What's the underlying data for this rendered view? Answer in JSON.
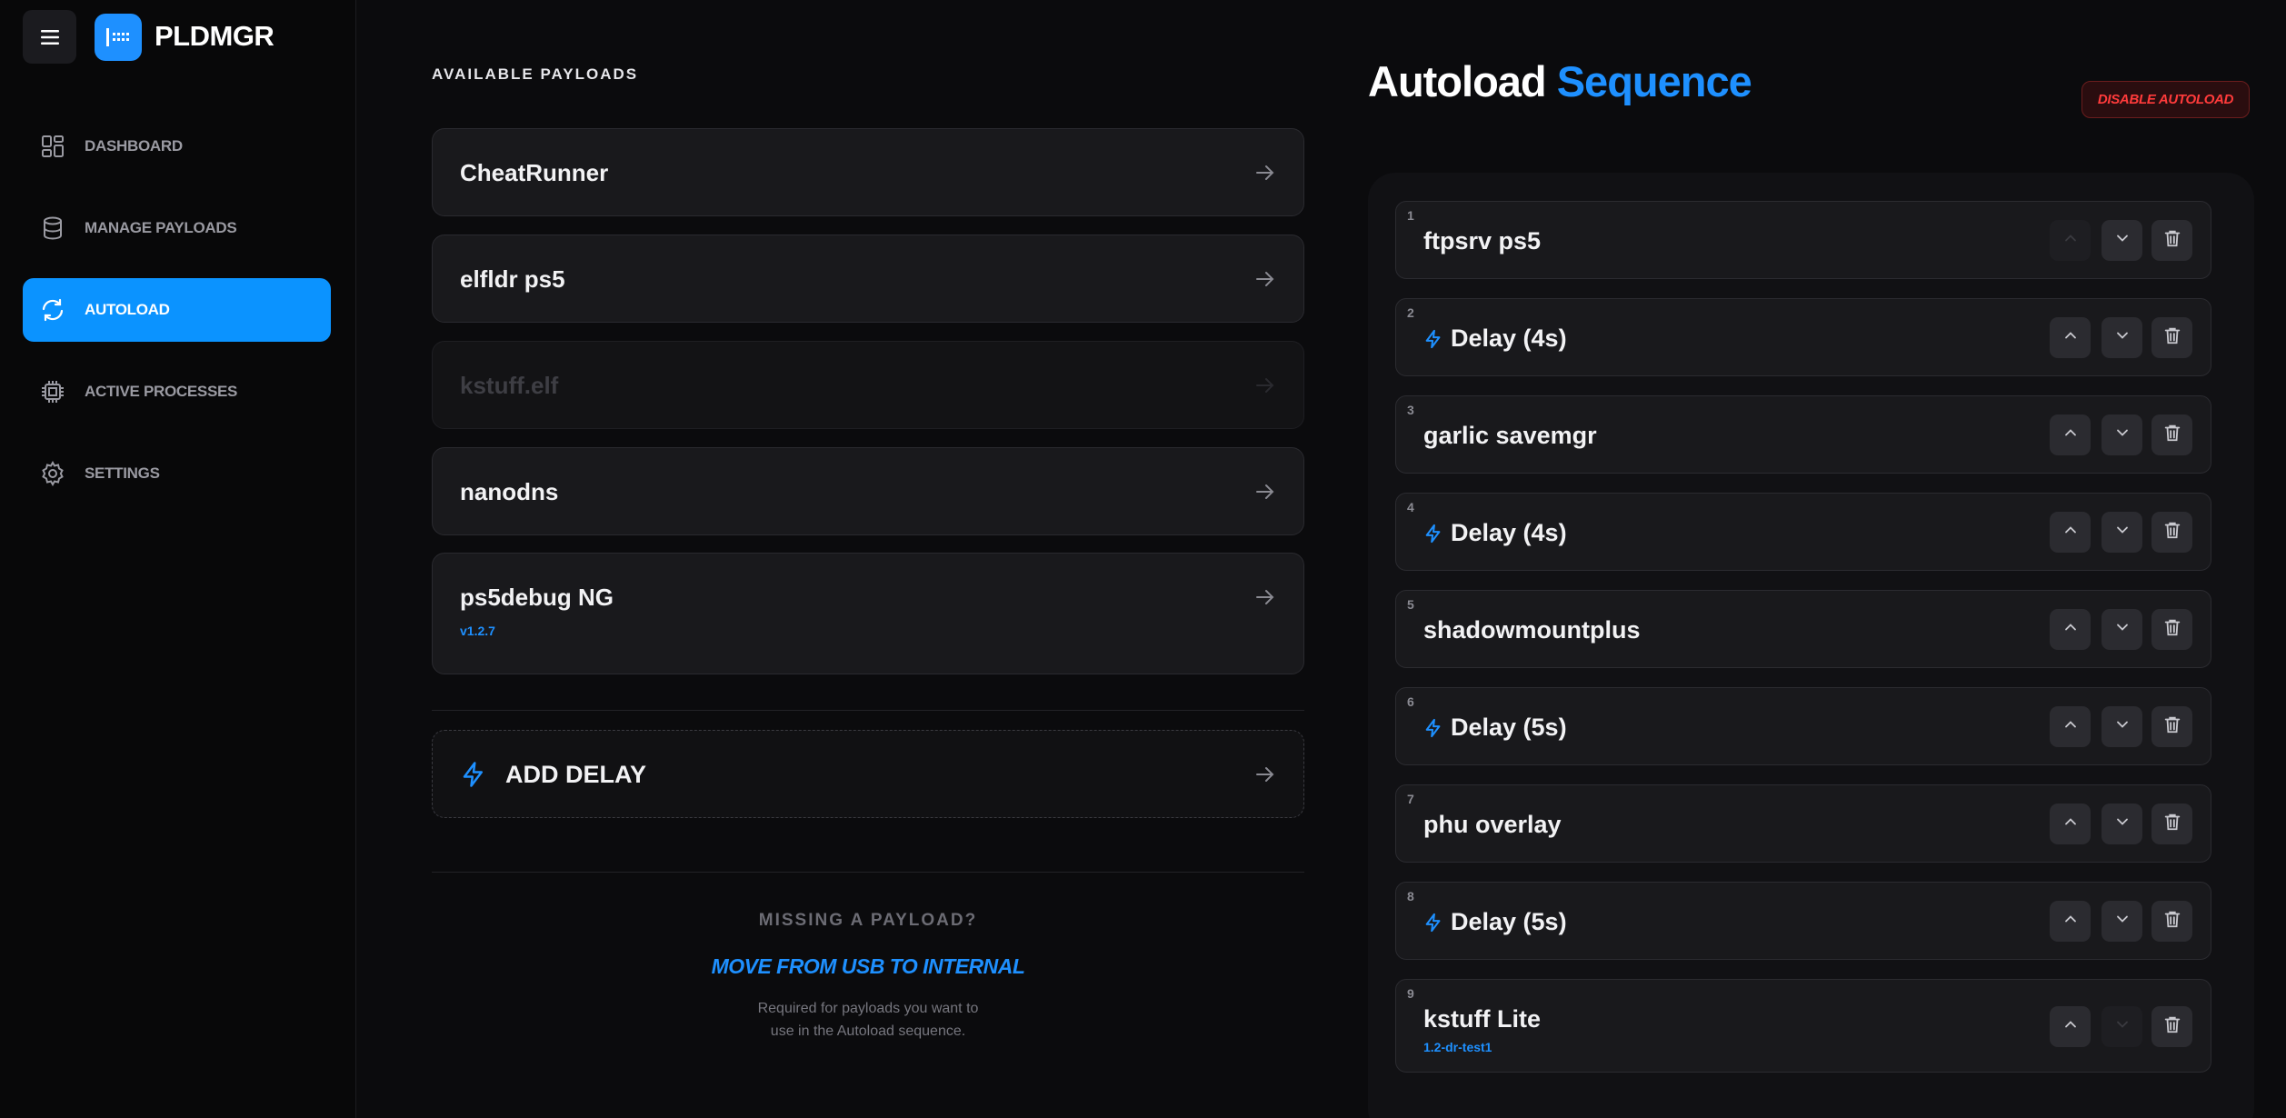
{
  "app": {
    "title": "PLDMGR",
    "icons": {
      "menu": "hamburger-icon",
      "logo": "grid-logo-icon"
    }
  },
  "sidebar": {
    "items": [
      {
        "label": "DASHBOARD",
        "icon": "dashboard-icon",
        "active": false
      },
      {
        "label": "MANAGE PAYLOADS",
        "icon": "database-icon",
        "active": false
      },
      {
        "label": "AUTOLOAD",
        "icon": "refresh-icon",
        "active": true
      },
      {
        "label": "ACTIVE PROCESSES",
        "icon": "cpu-icon",
        "active": false
      },
      {
        "label": "SETTINGS",
        "icon": "gear-icon",
        "active": false
      }
    ]
  },
  "available": {
    "heading": "AVAILABLE PAYLOADS",
    "payloads": [
      {
        "name": "CheatRunner",
        "version": "",
        "enabled": true
      },
      {
        "name": "elfldr ps5",
        "version": "",
        "enabled": true
      },
      {
        "name": "kstuff.elf",
        "version": "",
        "enabled": false
      },
      {
        "name": "nanodns",
        "version": "",
        "enabled": true
      },
      {
        "name": "ps5debug NG",
        "version": "v1.2.7",
        "enabled": true
      }
    ],
    "add_delay_label": "ADD DELAY",
    "missing_label": "MISSING A PAYLOAD?",
    "move_link": "MOVE FROM USB TO INTERNAL",
    "note_line1": "Required for payloads you want to",
    "note_line2": "use in the Autoload sequence."
  },
  "sequence": {
    "title_main": "Autoload",
    "title_accent": "Sequence",
    "disable_button": "DISABLE AUTOLOAD",
    "items": [
      {
        "index": "1",
        "label": "ftpsrv ps5",
        "is_delay": false,
        "sub": ""
      },
      {
        "index": "2",
        "label": "Delay (4s)",
        "is_delay": true,
        "sub": ""
      },
      {
        "index": "3",
        "label": "garlic savemgr",
        "is_delay": false,
        "sub": ""
      },
      {
        "index": "4",
        "label": "Delay (4s)",
        "is_delay": true,
        "sub": ""
      },
      {
        "index": "5",
        "label": "shadowmountplus",
        "is_delay": false,
        "sub": ""
      },
      {
        "index": "6",
        "label": "Delay (5s)",
        "is_delay": true,
        "sub": ""
      },
      {
        "index": "7",
        "label": "phu overlay",
        "is_delay": false,
        "sub": ""
      },
      {
        "index": "8",
        "label": "Delay (5s)",
        "is_delay": true,
        "sub": ""
      },
      {
        "index": "9",
        "label": "kstuff Lite",
        "is_delay": false,
        "sub": "1.2-dr-test1"
      }
    ]
  },
  "colors": {
    "accent": "#1e90ff",
    "active_nav": "#0b93ff",
    "danger": "#ff3b3b",
    "background": "#0b0b0d",
    "card": "#19191c"
  }
}
